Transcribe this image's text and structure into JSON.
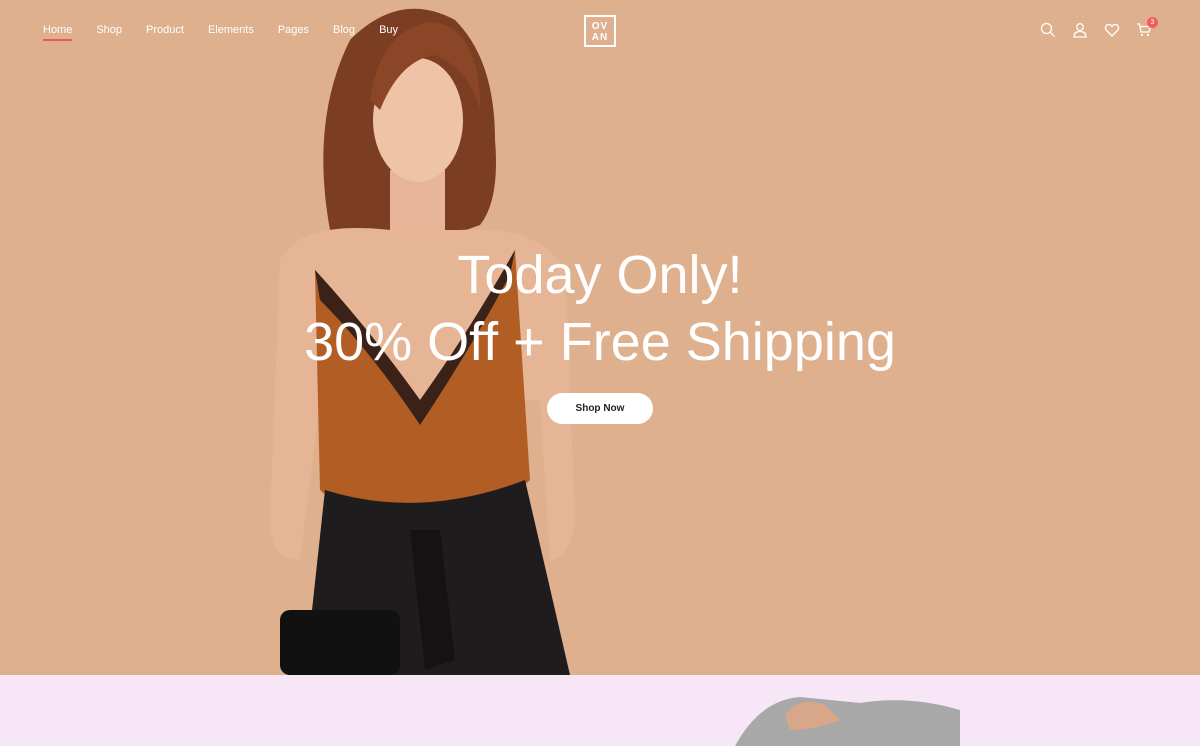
{
  "nav": {
    "items": [
      {
        "label": "Home",
        "active": true
      },
      {
        "label": "Shop"
      },
      {
        "label": "Product"
      },
      {
        "label": "Elements"
      },
      {
        "label": "Pages"
      },
      {
        "label": "Blog"
      },
      {
        "label": "Buy"
      }
    ],
    "logo": {
      "line1": "OV",
      "line2": "AN"
    },
    "icons": [
      "search-icon",
      "user-icon",
      "heart-icon",
      "cart-icon"
    ],
    "cart_count": "3"
  },
  "hero": {
    "headline_1": "Today Only!",
    "headline_2": "30% Off + Free Shipping",
    "cta_label": "Shop Now",
    "background": "#dfb08d"
  },
  "next_section": {
    "background": "#f6e6f6"
  },
  "colors": {
    "accent": "#e8575f",
    "badge": "#f25c5c"
  }
}
